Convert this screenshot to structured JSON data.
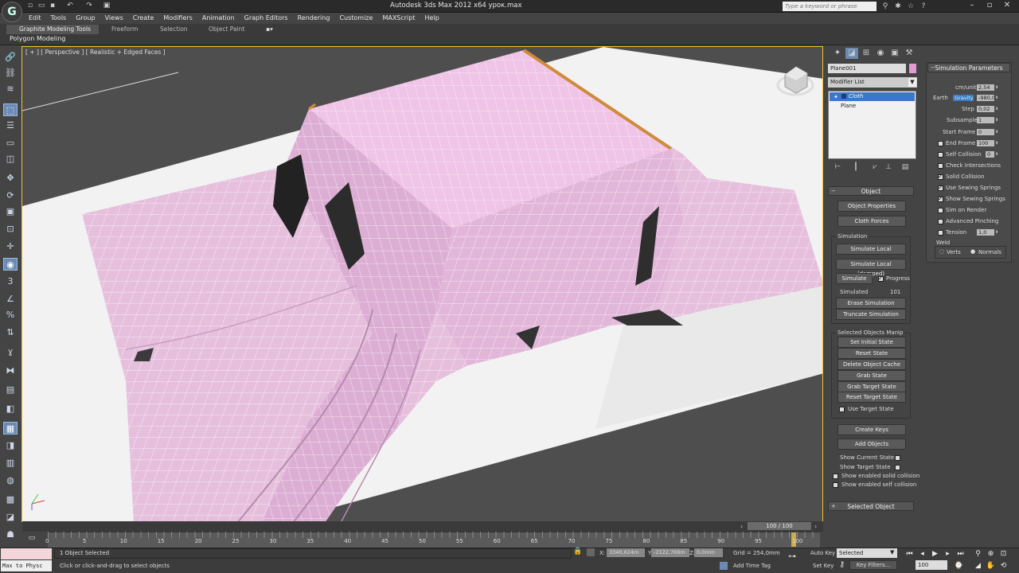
{
  "app": {
    "title": "Autodesk 3ds Max  2012 x64     урок.max",
    "logo_letter": "G",
    "search_placeholder": "Type a keyword or phrase"
  },
  "menu": [
    "Edit",
    "Tools",
    "Group",
    "Views",
    "Create",
    "Modifiers",
    "Animation",
    "Graph Editors",
    "Rendering",
    "Customize",
    "MAXScript",
    "Help"
  ],
  "ribbon": {
    "tabs": [
      "Graphite Modeling Tools",
      "Freeform",
      "Selection",
      "Object Paint"
    ],
    "panel_label": "Polygon Modeling"
  },
  "viewport": {
    "label": "[ + ] [ Perspective ] [ Realistic + Edged Faces ]"
  },
  "command_panel": {
    "object_name": "Plane001",
    "object_color": "#e29ad2",
    "modifier_list_label": "Modifier List",
    "stack": [
      "Cloth",
      "Plane"
    ],
    "object_rollout": "Object",
    "object_properties": "Object Properties",
    "cloth_forces": "Cloth Forces",
    "simulation_group": "Simulation",
    "simulate_local": "Simulate Local",
    "simulate_local_damped": "Simulate Local (damped)",
    "simulate": "Simulate",
    "progress": "Progress",
    "simulated_label": "Simulated",
    "simulated_value": "101",
    "erase_simulation": "Erase Simulation",
    "truncate_simulation": "Truncate Simulation",
    "selected_objects_manip": "Selected Objects Manip",
    "set_initial_state": "Set Initial State",
    "reset_state": "Reset State",
    "delete_object_cache": "Delete Object Cache",
    "grab_state": "Grab State",
    "grab_target_state": "Grab Target State",
    "reset_target_state": "Reset Target State",
    "use_target_state": "Use Target State",
    "create_keys": "Create Keys",
    "add_objects": "Add Objects",
    "show_current_state": "Show Current State",
    "show_target_state": "Show Target State",
    "show_enabled_solid": "Show enabled solid collision",
    "show_enabled_self": "Show enabled self collision",
    "selected_object_rollout": "Selected Object"
  },
  "sim_params": {
    "header": "Simulation Parameters",
    "cm_unit_label": "cm/unit",
    "cm_unit_value": "2,54",
    "earth_label": "Earth",
    "gravity_label": "Gravity",
    "gravity_value": "-980,0",
    "step_label": "Step",
    "step_value": "0,02",
    "subsample_label": "Subsample",
    "subsample_value": "1",
    "start_frame_label": "Start Frame",
    "start_frame_value": "0",
    "end_frame_label": "End Frame",
    "end_frame_value": "100",
    "self_collision_label": "Self Collision",
    "self_collision_value": "0",
    "check_intersections": "Check Intersections",
    "solid_collision": "Solid Collision",
    "use_sewing_springs": "Use Sewing Springs",
    "show_sewing_springs": "Show Sewing Springs",
    "sim_on_render": "Sim on Render",
    "advanced_pinching": "Advanced Pinching",
    "tension_label": "Tension",
    "tension_value": "1,0",
    "weld_label": "Weld",
    "verts": "Verts",
    "normals": "Normals"
  },
  "timeline": {
    "position": "100 / 100",
    "ticks": [
      "0",
      "5",
      "10",
      "15",
      "20",
      "25",
      "30",
      "35",
      "40",
      "45",
      "50",
      "55",
      "60",
      "65",
      "70",
      "75",
      "80",
      "85",
      "90",
      "95",
      "100"
    ]
  },
  "status": {
    "maxscript_text": "Max to Physc",
    "selection_count": "1 Object Selected",
    "prompt": "Click or click-and-drag to select objects",
    "x_label": "X:",
    "x_value": "3340,624m",
    "y_label": "Y:",
    "y_value": "-2122,769m",
    "z_label": "Z:",
    "z_value": "0,0mm",
    "grid": "Grid = 254,0mm",
    "add_time_tag": "Add Time Tag",
    "auto_key": "Auto Key",
    "selected": "Selected",
    "set_key": "Set Key",
    "key_filters": "Key Filters...",
    "frame_value": "100"
  }
}
